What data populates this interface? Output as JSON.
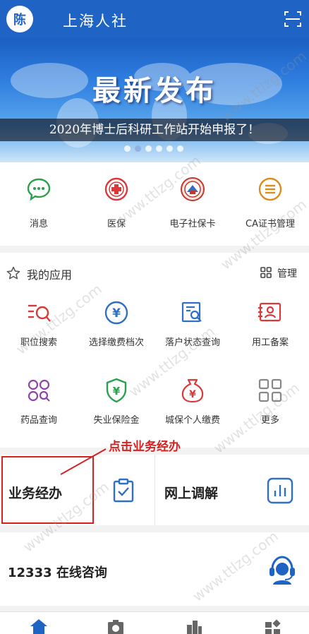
{
  "header": {
    "avatar_text": "陈",
    "title": "上海人社",
    "scan_icon": "scan-icon"
  },
  "banner": {
    "headline": "最新发布",
    "caption": "2020年博士后科研工作站开始申报了！",
    "slides": 6,
    "active_slide": 2
  },
  "quick_actions": [
    {
      "label": "消息",
      "icon": "message-icon",
      "color": "#2aa14c"
    },
    {
      "label": "医保",
      "icon": "medical-insurance-icon",
      "color": "#d83a3a"
    },
    {
      "label": "电子社保卡",
      "icon": "social-security-card-icon",
      "color": "#c0392b"
    },
    {
      "label": "CA证书管理",
      "icon": "ca-certificate-icon",
      "color": "#e08a1e"
    }
  ],
  "my_apps": {
    "title": "我的应用",
    "manage_label": "管理",
    "items": [
      {
        "label": "职位搜索",
        "icon": "job-search-icon",
        "color": "#d83a3a"
      },
      {
        "label": "选择缴费档次",
        "icon": "payment-level-icon",
        "color": "#2f6fc4"
      },
      {
        "label": "落户状态查询",
        "icon": "settlement-query-icon",
        "color": "#2f6fc4"
      },
      {
        "label": "用工备案",
        "icon": "employment-record-icon",
        "color": "#d83a3a"
      },
      {
        "label": "药品查询",
        "icon": "drug-query-icon",
        "color": "#8e44ad"
      },
      {
        "label": "失业保险金",
        "icon": "unemployment-insurance-icon",
        "color": "#2aa14c"
      },
      {
        "label": "城保个人缴费",
        "icon": "personal-payment-icon",
        "color": "#d83a3a"
      },
      {
        "label": "更多",
        "icon": "more-icon",
        "color": "#888888"
      }
    ]
  },
  "business": [
    {
      "label": "业务经办",
      "icon": "clipboard-check-icon"
    },
    {
      "label": "网上调解",
      "icon": "bar-chart-icon"
    }
  ],
  "annotation": {
    "text": "点击业务经办",
    "color": "#d32323"
  },
  "hotline": {
    "label": "12333 在线咨询",
    "icon": "customer-service-icon"
  },
  "tabbar": [
    {
      "icon": "home-icon",
      "color": "#1f63c5"
    },
    {
      "icon": "camera-icon",
      "color": "#666666"
    },
    {
      "icon": "building-icon",
      "color": "#666666"
    },
    {
      "icon": "grid-icon",
      "color": "#666666"
    }
  ],
  "watermark": "www.ttlzg.com"
}
